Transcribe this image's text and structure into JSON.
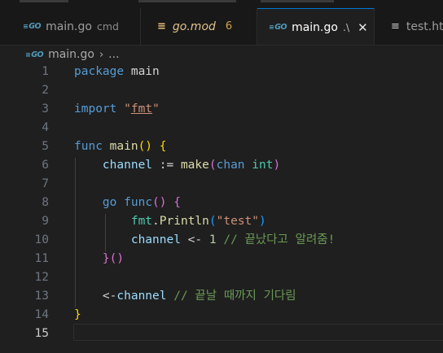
{
  "tabs": [
    {
      "icon": "go-icon",
      "name": "main.go",
      "description": "cmd",
      "active": false
    },
    {
      "icon": "mod-icon",
      "name": "go.mod",
      "badge": "6",
      "active": false
    },
    {
      "icon": "go-icon",
      "name": "main.go",
      "description": ".\\",
      "active": true
    },
    {
      "icon": "braces-icon",
      "name": "test.htt",
      "active": false
    }
  ],
  "breadcrumb": {
    "file": "main.go",
    "more": "..."
  },
  "editor": {
    "active_line": 15,
    "lines": [
      {
        "n": "1",
        "tokens": [
          [
            "kw",
            "package"
          ],
          [
            "plain",
            " main"
          ]
        ]
      },
      {
        "n": "2",
        "tokens": []
      },
      {
        "n": "3",
        "tokens": [
          [
            "kw",
            "import"
          ],
          [
            "plain",
            " "
          ],
          [
            "str",
            "\""
          ],
          [
            "str-u",
            "fmt"
          ],
          [
            "str",
            "\""
          ]
        ]
      },
      {
        "n": "4",
        "tokens": []
      },
      {
        "n": "5",
        "tokens": [
          [
            "kw",
            "func"
          ],
          [
            "plain",
            " "
          ],
          [
            "fn",
            "main"
          ],
          [
            "br1",
            "()"
          ],
          [
            "plain",
            " "
          ],
          [
            "br1",
            "{"
          ]
        ]
      },
      {
        "n": "6",
        "tokens": [
          [
            "plain",
            "    "
          ],
          [
            "var",
            "channel"
          ],
          [
            "plain",
            " := "
          ],
          [
            "fn",
            "make"
          ],
          [
            "br2",
            "("
          ],
          [
            "kw",
            "chan"
          ],
          [
            "plain",
            " "
          ],
          [
            "pkg",
            "int"
          ],
          [
            "br2",
            ")"
          ]
        ]
      },
      {
        "n": "7",
        "tokens": []
      },
      {
        "n": "8",
        "tokens": [
          [
            "plain",
            "    "
          ],
          [
            "kw",
            "go"
          ],
          [
            "plain",
            " "
          ],
          [
            "kw",
            "func"
          ],
          [
            "br2",
            "()"
          ],
          [
            "plain",
            " "
          ],
          [
            "br2",
            "{"
          ]
        ]
      },
      {
        "n": "9",
        "tokens": [
          [
            "plain",
            "        "
          ],
          [
            "pkg",
            "fmt"
          ],
          [
            "plain",
            "."
          ],
          [
            "fn",
            "Println"
          ],
          [
            "br3",
            "("
          ],
          [
            "str",
            "\"test\""
          ],
          [
            "br3",
            ")"
          ]
        ]
      },
      {
        "n": "10",
        "tokens": [
          [
            "plain",
            "        "
          ],
          [
            "var",
            "channel"
          ],
          [
            "plain",
            " <- "
          ],
          [
            "num",
            "1"
          ],
          [
            "plain",
            " "
          ],
          [
            "cmt",
            "// 끝났다고 알려줌!"
          ]
        ]
      },
      {
        "n": "11",
        "tokens": [
          [
            "plain",
            "    "
          ],
          [
            "br2",
            "}"
          ],
          [
            "br2",
            "()"
          ]
        ]
      },
      {
        "n": "12",
        "tokens": []
      },
      {
        "n": "13",
        "tokens": [
          [
            "plain",
            "    <-"
          ],
          [
            "var",
            "channel"
          ],
          [
            "plain",
            " "
          ],
          [
            "cmt",
            "// 끝날 때까지 기다림"
          ]
        ]
      },
      {
        "n": "14",
        "tokens": [
          [
            "br1",
            "}"
          ]
        ]
      },
      {
        "n": "15",
        "tokens": []
      }
    ]
  }
}
